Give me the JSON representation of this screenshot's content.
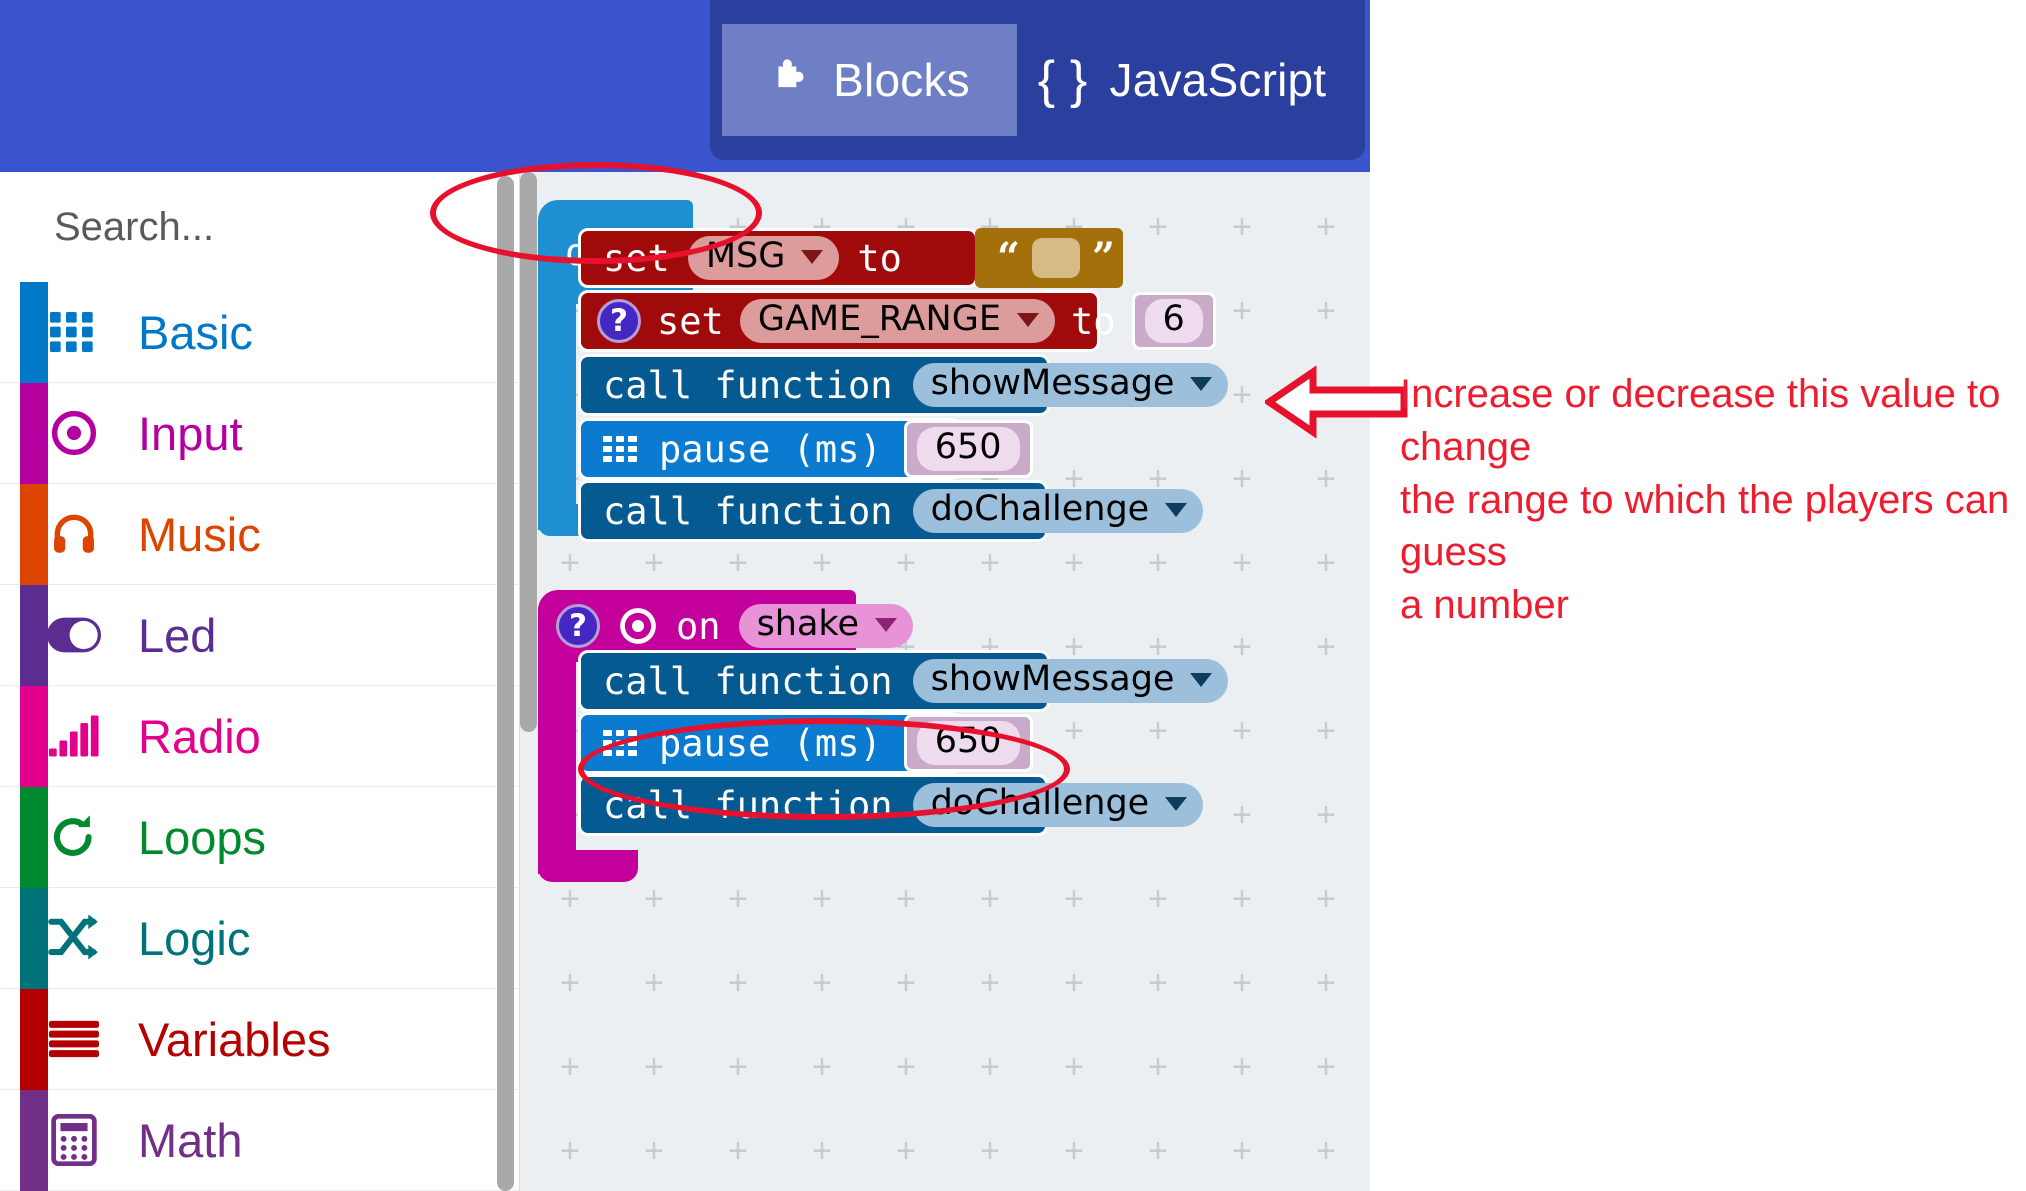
{
  "header": {
    "tabs": [
      {
        "label": "Blocks",
        "icon": "puzzle-piece-icon",
        "active": true
      },
      {
        "label": "JavaScript",
        "icon": "curly-braces-icon",
        "active": false
      }
    ],
    "bar_color": "#3a54cd",
    "tab_group_color": "#2b3f9e",
    "active_tab_color": "#6e7fc6"
  },
  "sidebar": {
    "search": {
      "placeholder": "Search...",
      "value": "",
      "icon": "search-icon"
    },
    "categories": [
      {
        "label": "Basic",
        "icon": "grid-3x3-icon",
        "color": "#0078c8"
      },
      {
        "label": "Input",
        "icon": "target-dot-icon",
        "color": "#b4009e"
      },
      {
        "label": "Music",
        "icon": "headphones-icon",
        "color": "#dd4402"
      },
      {
        "label": "Led",
        "icon": "toggle-on-icon",
        "color": "#5c2d91"
      },
      {
        "label": "Radio",
        "icon": "signal-bars-icon",
        "color": "#e3008c"
      },
      {
        "label": "Loops",
        "icon": "refresh-loop-icon",
        "color": "#00892f"
      },
      {
        "label": "Logic",
        "icon": "shuffle-arrow-icon",
        "color": "#00727a"
      },
      {
        "label": "Variables",
        "icon": "stacked-lines-icon",
        "color": "#b50000"
      },
      {
        "label": "Math",
        "icon": "calculator-icon",
        "color": "#712f87"
      }
    ]
  },
  "workspace": {
    "background": "#eceff1",
    "scripts": [
      {
        "name": "on-start-script",
        "hat": {
          "text": "on start",
          "color": "#1e90d2",
          "highlighted": true
        },
        "statements": [
          {
            "kind": "set-variable",
            "keyword": "set",
            "variable": "MSG",
            "to": "to",
            "color": "#a00a0a",
            "value_block": {
              "kind": "string-literal",
              "text": "",
              "color": "#a3700c",
              "open_quote": "“",
              "close_quote": "”"
            }
          },
          {
            "kind": "set-variable",
            "help_badge": "?",
            "keyword": "set",
            "variable": "GAME_RANGE",
            "to": "to",
            "color": "#a00a0a",
            "value_block": {
              "kind": "number-literal",
              "text": "6"
            }
          },
          {
            "kind": "call-function",
            "keyword": "call function",
            "function": "showMessage",
            "color": "#055a92"
          },
          {
            "kind": "pause",
            "icon": "grid-3x3-icon",
            "keyword": "pause (ms)",
            "color": "#0b7ad1",
            "value_block": {
              "kind": "number-literal",
              "text": "650"
            }
          },
          {
            "kind": "call-function",
            "keyword": "call function",
            "function": "doChallenge",
            "color": "#055a92"
          }
        ]
      },
      {
        "name": "on-shake-script",
        "hat": {
          "help_badge": "?",
          "icon": "target-dot-icon",
          "keyword": "on",
          "event": "shake",
          "color": "#c4009c",
          "highlighted": true
        },
        "statements": [
          {
            "kind": "call-function",
            "keyword": "call function",
            "function": "showMessage",
            "color": "#055a92"
          },
          {
            "kind": "pause",
            "icon": "grid-3x3-icon",
            "keyword": "pause (ms)",
            "color": "#0b7ad1",
            "value_block": {
              "kind": "number-literal",
              "text": "650"
            }
          },
          {
            "kind": "call-function",
            "keyword": "call function",
            "function": "doChallenge",
            "color": "#055a92"
          }
        ]
      }
    ]
  },
  "annotations": {
    "color": "#ed1c2e",
    "note_lines": [
      "Increase or decrease this value to change",
      "the range to which the players can guess",
      "a number"
    ],
    "arrow": "left-arrow-callout",
    "ellipses": [
      "on-start-highlight",
      "on-shake-highlight"
    ]
  }
}
